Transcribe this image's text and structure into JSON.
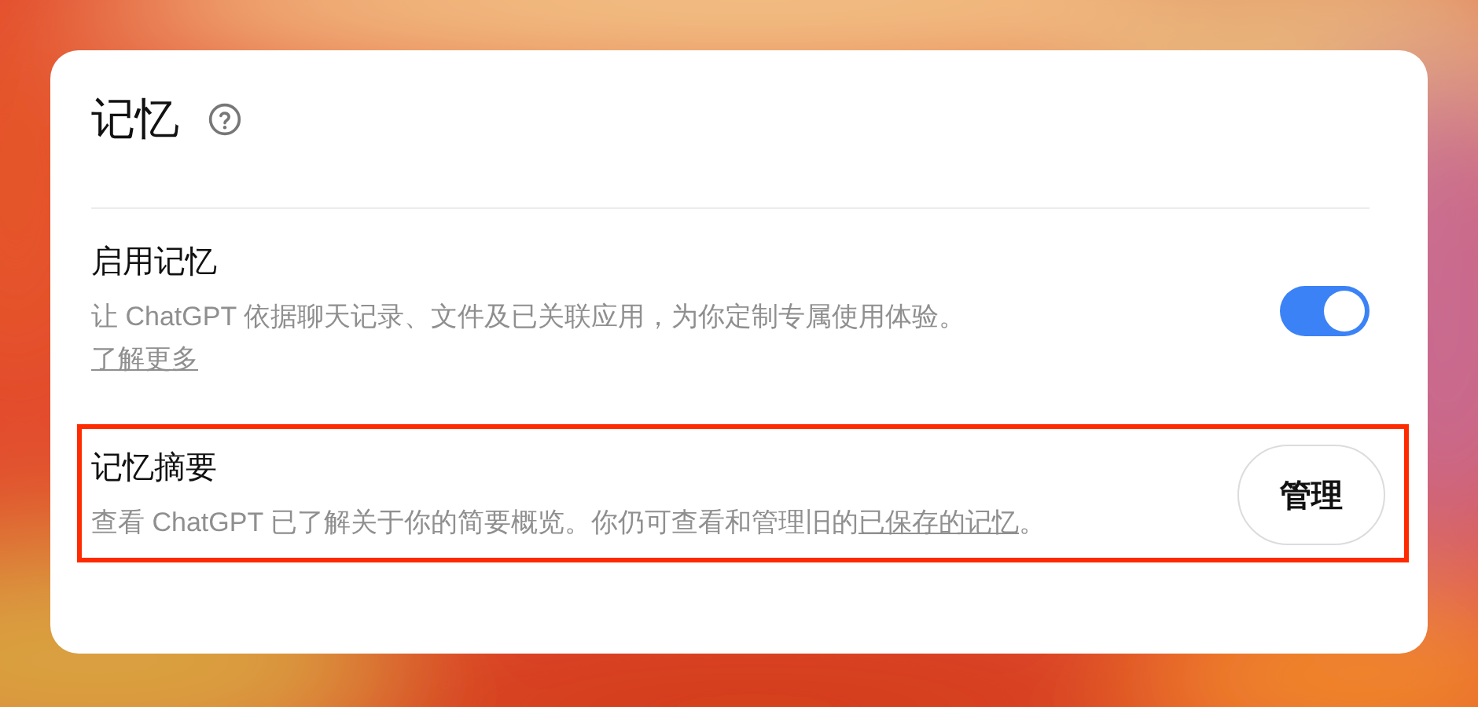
{
  "panel": {
    "title": "记忆"
  },
  "settings": [
    {
      "kind": "toggle",
      "title": "启用记忆",
      "description": "让 ChatGPT 依据聊天记录、文件及已关联应用，为你定制专属使用体验。",
      "link": "了解更多",
      "on": true,
      "highlighted": false
    },
    {
      "kind": "button",
      "title": "记忆摘要",
      "description": "查看 ChatGPT 已了解关于你的简要概览。你仍可查看和管理旧的",
      "link": "已保存的记忆",
      "link_suffix": "。",
      "button": "管理",
      "highlighted": true
    }
  ]
}
